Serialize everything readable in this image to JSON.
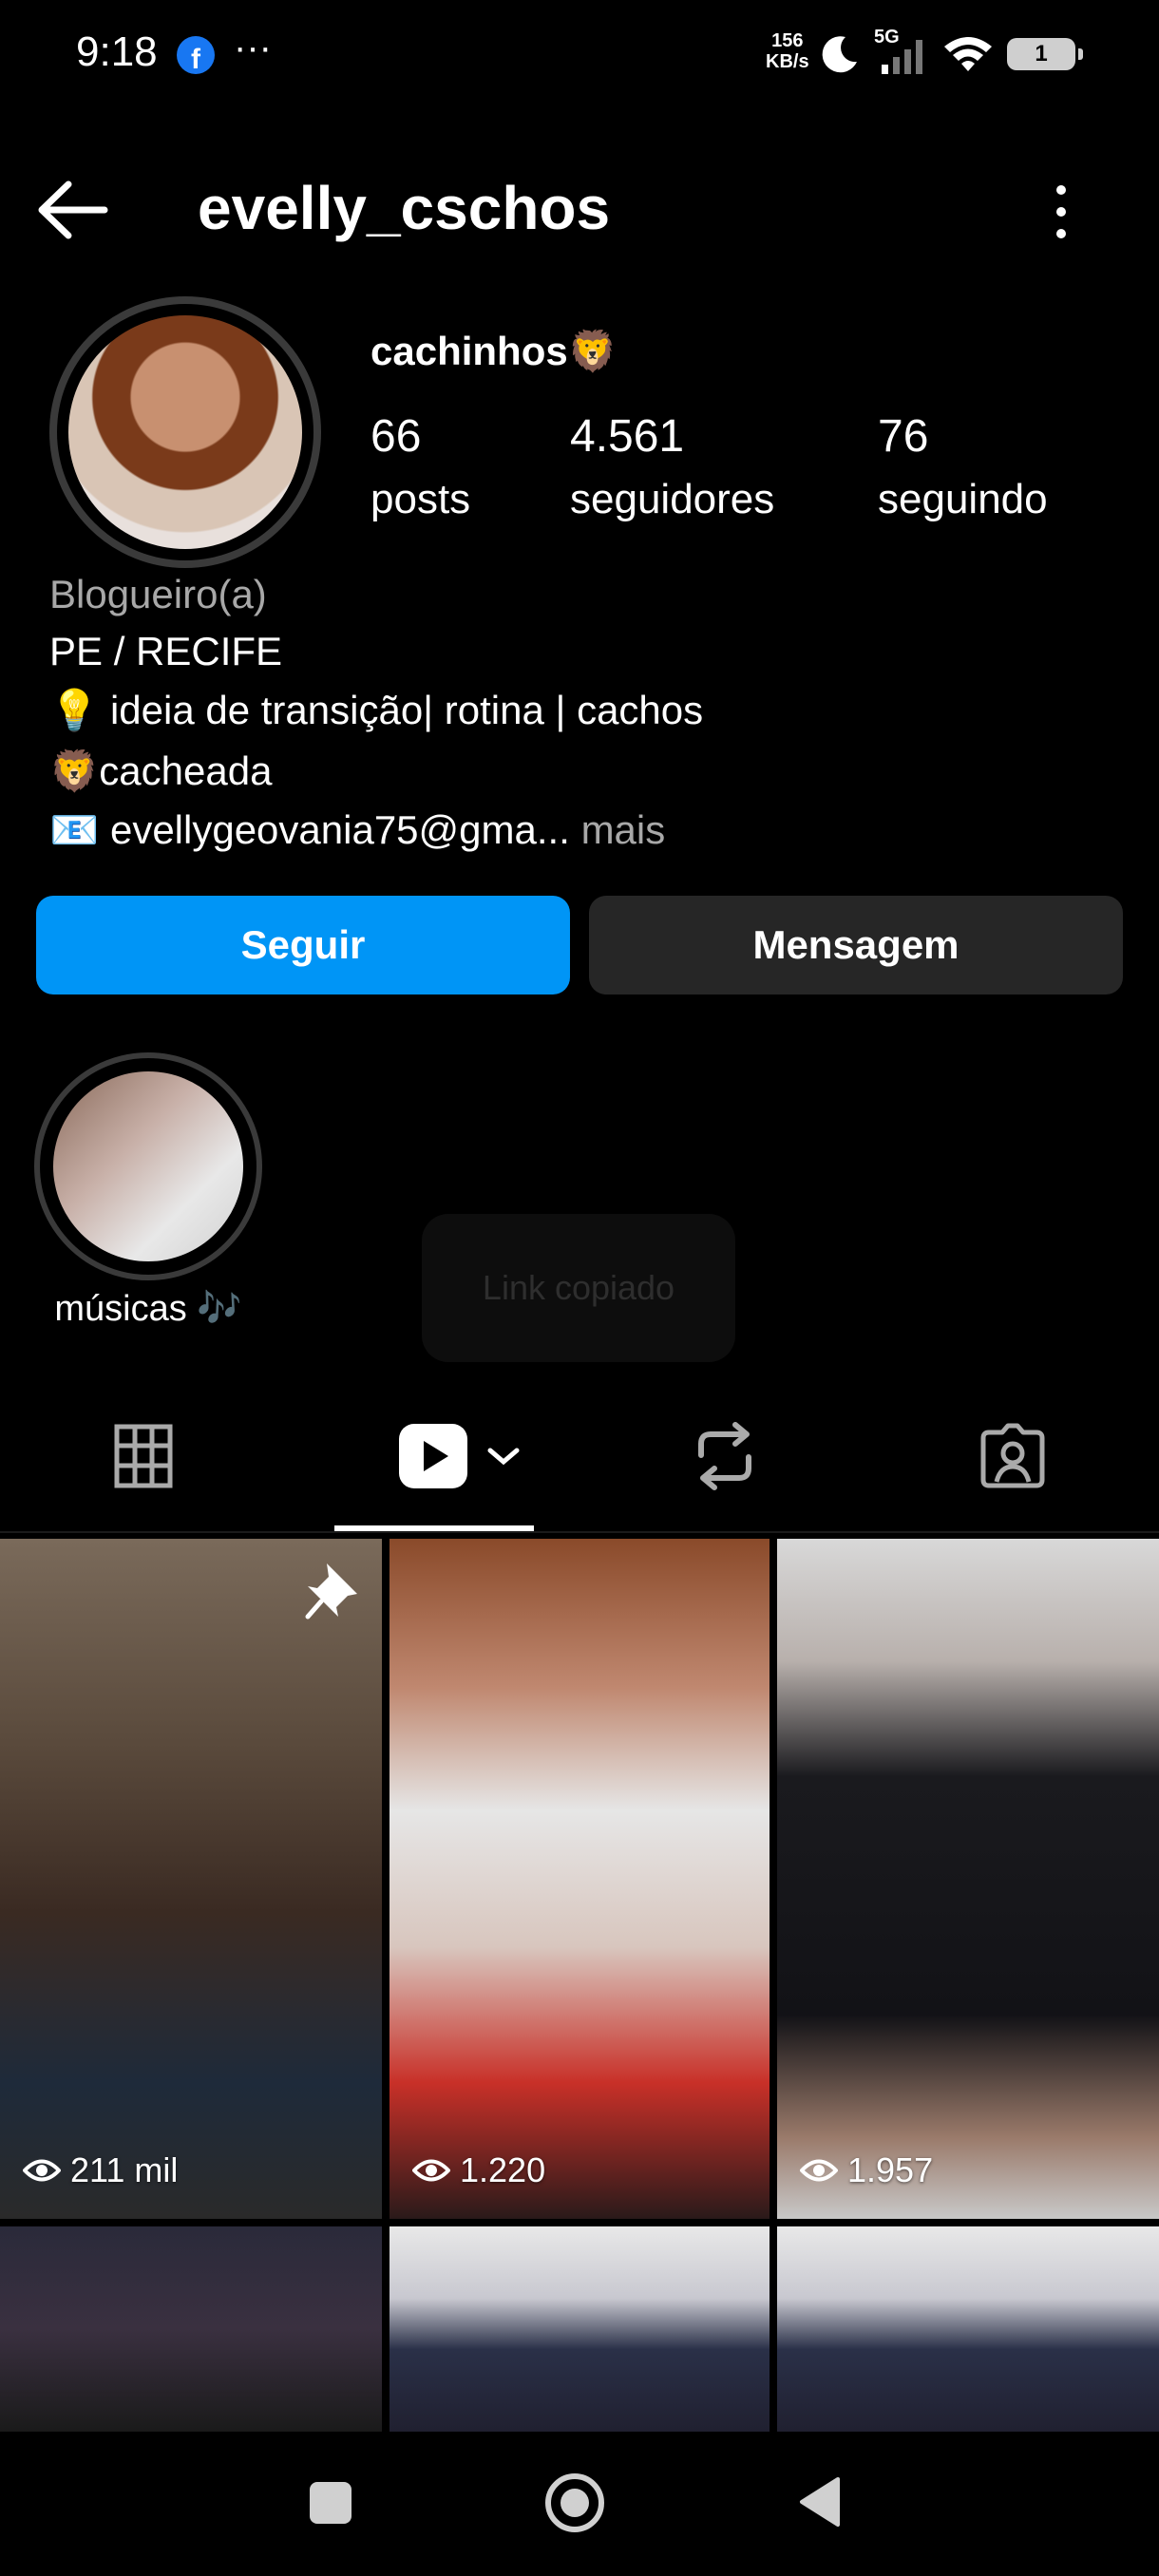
{
  "status_bar": {
    "time": "9:18",
    "fb_letter": "f",
    "more": "···",
    "net_speed_value": "156",
    "net_speed_unit": "KB/s",
    "network": "5G",
    "battery": "1"
  },
  "header": {
    "username": "evelly_cschos"
  },
  "profile": {
    "display_name": "cachinhos🦁",
    "stats": [
      {
        "value": "66",
        "label": "posts"
      },
      {
        "value": "4.561",
        "label": "seguidores"
      },
      {
        "value": "76",
        "label": "seguindo"
      }
    ],
    "category": "Blogueiro(a)",
    "bio_lines": [
      "PE / RECIFE",
      "💡  ideia de transição| rotina  | cachos",
      "🦁cacheada",
      "📧 evellygeovania75@gma..."
    ],
    "more_label": "mais"
  },
  "actions": {
    "follow": "Seguir",
    "message": "Mensagem"
  },
  "highlights": [
    {
      "label": "músicas 🎶"
    }
  ],
  "toast": "Link copiado",
  "tabs": [
    {
      "icon": "grid-icon"
    },
    {
      "icon": "reels-icon",
      "selected": true
    },
    {
      "icon": "reposts-icon"
    },
    {
      "icon": "tagged-icon"
    }
  ],
  "reels": [
    {
      "views": "211 mil",
      "pinned": true
    },
    {
      "views": "1.220"
    },
    {
      "views": "1.957"
    }
  ],
  "colors": {
    "accent": "#0095f6",
    "background": "#000000",
    "secondary_button": "#262626",
    "muted_text": "#a8a8a8"
  }
}
